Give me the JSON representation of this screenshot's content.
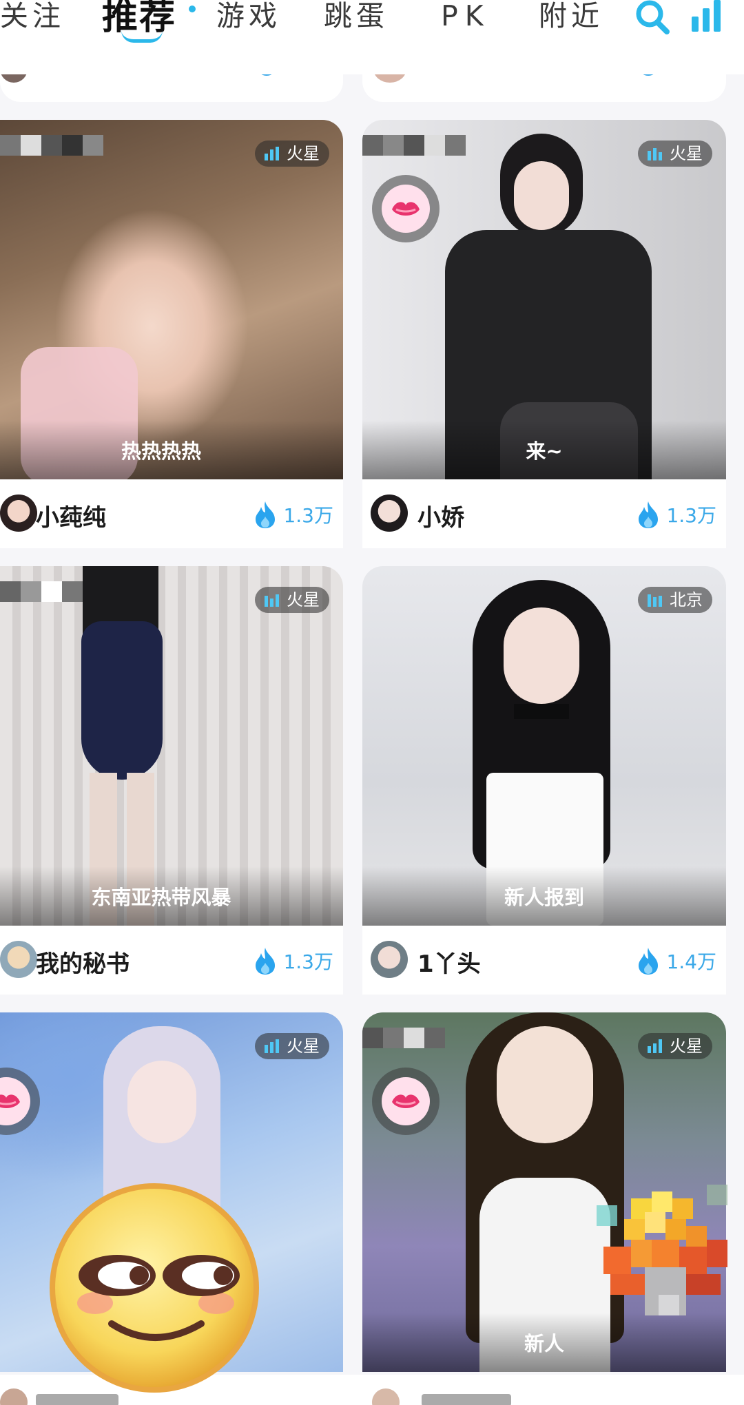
{
  "tabs": [
    {
      "label": "关注",
      "active": false
    },
    {
      "label": "推荐",
      "active": true
    },
    {
      "label": "游戏",
      "active": false
    },
    {
      "label": "跳蛋",
      "active": false
    },
    {
      "label": "PK",
      "active": false
    },
    {
      "label": "附近",
      "active": false
    }
  ],
  "top_icons": [
    "search-icon",
    "ranking-icon"
  ],
  "accent_color": "#2bb8ea",
  "heat_color": "#3aa8e8",
  "cards": [
    {
      "caption": "热热热热",
      "location": "火星",
      "name": "小莼纯",
      "heat": "1.3万",
      "has_lips_badge": false
    },
    {
      "caption": "来~",
      "location": "火星",
      "name": "小娇",
      "heat": "1.3万",
      "has_lips_badge": true
    },
    {
      "caption": "东南亚热带风暴",
      "location": "火星",
      "name": "我的秘书",
      "heat": "1.3万",
      "has_lips_badge": false
    },
    {
      "caption": "新人报到",
      "location": "北京",
      "name": "1丫头",
      "heat": "1.4万",
      "has_lips_badge": false
    },
    {
      "caption": "",
      "location": "火星",
      "name": "",
      "heat": "",
      "has_lips_badge": true
    },
    {
      "caption": "新人",
      "location": "火星",
      "name": "",
      "heat": "",
      "has_lips_badge": true
    }
  ]
}
